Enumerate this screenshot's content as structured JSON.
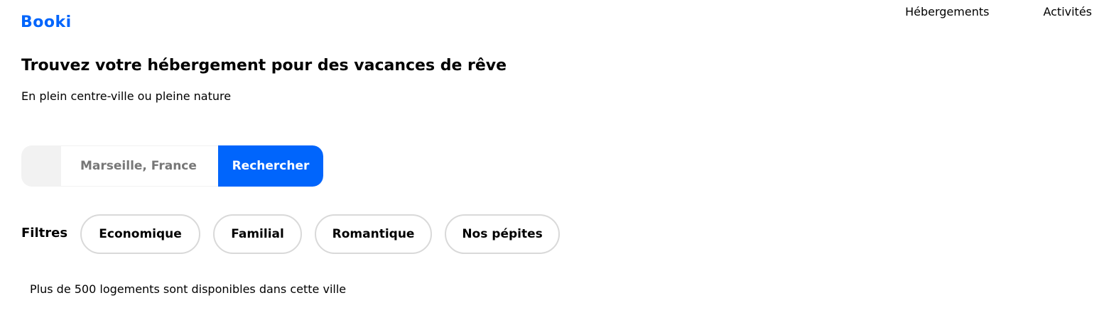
{
  "header": {
    "logo_text": "Booki",
    "brand_color": "#0065FC",
    "nav": [
      {
        "label": "Hébergements"
      },
      {
        "label": "Activités"
      }
    ]
  },
  "hero": {
    "title": "Trouvez votre hébergement pour des vacances de rêve",
    "subtitle": "En plein centre-ville ou pleine nature"
  },
  "search": {
    "icon": "search-icon",
    "placeholder": "Marseille, France",
    "value": "",
    "button_label": "Rechercher"
  },
  "filters": {
    "label": "Filtres",
    "chips": [
      {
        "label": "Economique"
      },
      {
        "label": "Familial"
      },
      {
        "label": "Romantique"
      },
      {
        "label": "Nos pépites"
      }
    ]
  },
  "results": {
    "text": "Plus de 500 logements sont disponibles dans cette ville"
  }
}
